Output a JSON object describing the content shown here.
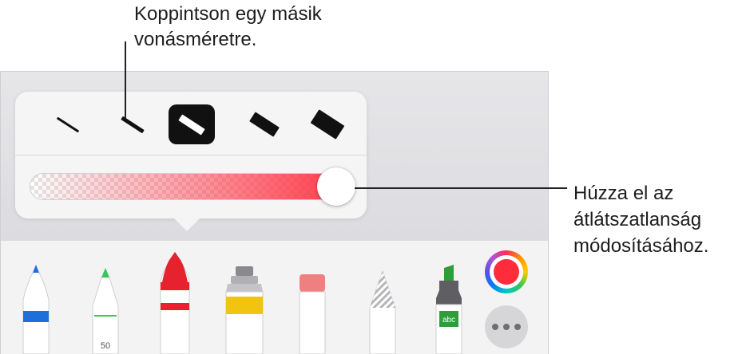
{
  "callouts": {
    "stroke_size": "Koppintson egy másik\nvonásméretre.",
    "opacity_line1": "Húzza el az",
    "opacity_line2": "átlátszatlanság",
    "opacity_line3": "módosításához."
  },
  "stroke_sizes": [
    {
      "name": "stroke-size-1",
      "selected": false
    },
    {
      "name": "stroke-size-2",
      "selected": false
    },
    {
      "name": "stroke-size-3",
      "selected": true
    },
    {
      "name": "stroke-size-4",
      "selected": false
    },
    {
      "name": "stroke-size-5",
      "selected": false
    }
  ],
  "opacity": {
    "value": 1.0,
    "color": "#ff3848"
  },
  "tools": [
    {
      "name": "pen",
      "icon": "pen-icon",
      "color": "#1e6fd9"
    },
    {
      "name": "pencil",
      "icon": "pencil-icon",
      "color": "#34c759",
      "label": "50"
    },
    {
      "name": "crayon",
      "icon": "crayon-icon",
      "color": "#e5222d",
      "selected": true
    },
    {
      "name": "paint",
      "icon": "paint-tube-icon",
      "color": "#f0c40f"
    },
    {
      "name": "eraser",
      "icon": "eraser-icon",
      "color": "#f08080"
    },
    {
      "name": "lasso",
      "icon": "lasso-icon",
      "color": "#a8a8a8"
    },
    {
      "name": "marker",
      "icon": "marker-icon",
      "color": "#2e9e3a",
      "label": "abc"
    }
  ],
  "color_picker": {
    "icon": "color-wheel-icon",
    "current": "#ff2d3b"
  },
  "more": {
    "icon": "more-icon"
  }
}
